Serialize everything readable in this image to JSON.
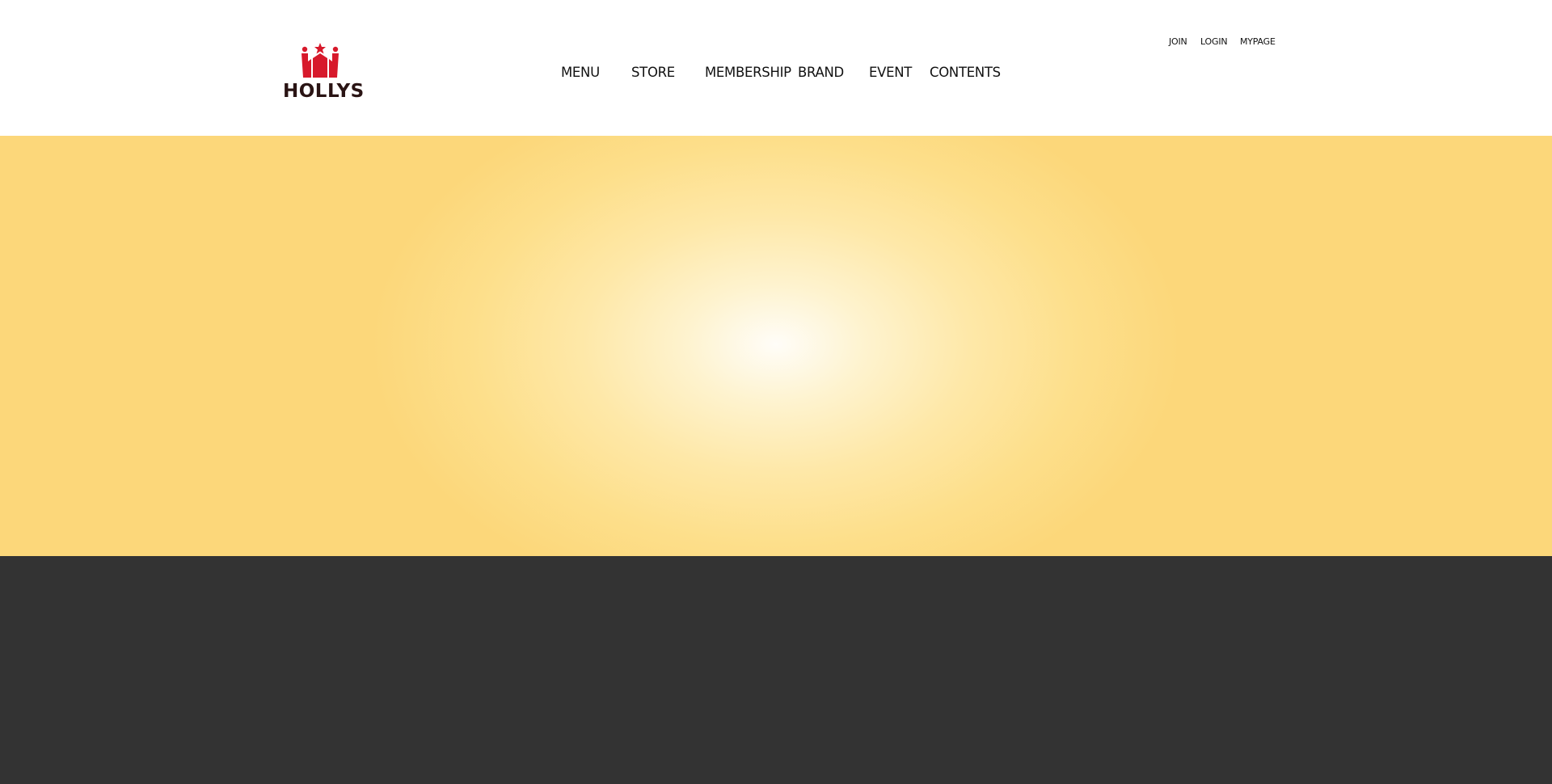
{
  "brand": {
    "name": "HOLLYS",
    "logo_color": "#d7192b",
    "text_color": "#2a1414"
  },
  "nav": {
    "items": [
      {
        "label": "MENU"
      },
      {
        "label": "STORE"
      },
      {
        "label": "MEMBERSHIP"
      },
      {
        "label": "BRAND"
      },
      {
        "label": "EVENT"
      },
      {
        "label": "CONTENTS"
      }
    ]
  },
  "util": {
    "join": "JOIN",
    "login": "LOGIN",
    "mypage": "MYPAGE"
  },
  "hero": {
    "background_color": "#fcd77a",
    "highlight_color": "#fffdf8"
  },
  "footer": {
    "background_color": "#333333"
  }
}
